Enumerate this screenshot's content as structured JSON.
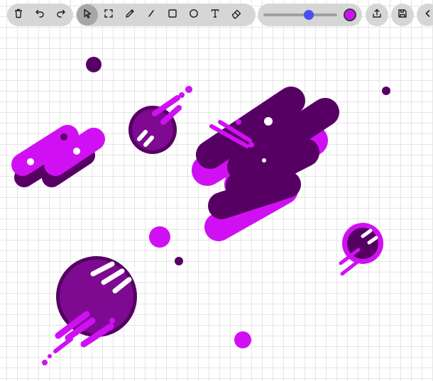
{
  "app": {
    "background": "#ffffff",
    "grid_color": "#e4e6e4"
  },
  "toolbar": {
    "history": [
      {
        "name": "delete-icon",
        "interactable": true
      },
      {
        "name": "undo-icon",
        "interactable": true
      },
      {
        "name": "redo-icon",
        "interactable": true
      }
    ],
    "tools": [
      {
        "name": "select-tool",
        "icon": "cursor-arrow-icon",
        "active": true
      },
      {
        "name": "marquee-tool",
        "icon": "marquee-select-icon",
        "active": false
      },
      {
        "name": "pencil-tool",
        "icon": "pencil-icon",
        "active": false
      },
      {
        "name": "line-tool",
        "icon": "line-icon",
        "active": false
      },
      {
        "name": "rectangle-tool",
        "icon": "square-icon",
        "active": false
      },
      {
        "name": "ellipse-tool",
        "icon": "circle-icon",
        "active": false
      },
      {
        "name": "text-tool",
        "icon": "text-t-icon",
        "active": false
      },
      {
        "name": "eraser-tool",
        "icon": "eraser-icon",
        "active": false
      }
    ],
    "stroke_size": {
      "level": 0.62,
      "thumb_color": "#4a4fee"
    },
    "current_color": "#d010f3",
    "actions": [
      {
        "name": "share-button",
        "icon": "export-icon"
      },
      {
        "name": "save-button",
        "icon": "save-icon"
      },
      {
        "name": "collapse-button",
        "icon": "chevron-left-icon"
      }
    ]
  },
  "drawing": {
    "colors": {
      "magenta": "#d010f3",
      "dark_purple": "#560063",
      "purple": "#7e0a91",
      "white": "#ffffff"
    },
    "objects": [
      "small-dark-dot-top-left",
      "dark-dot-top-right",
      "left-pill-cluster",
      "top-middle-planet",
      "center-pill-cluster",
      "center-magenta-dot",
      "small-dark-dot-center",
      "bottom-left-planet",
      "bottom-magenta-dot",
      "right-planet"
    ]
  }
}
